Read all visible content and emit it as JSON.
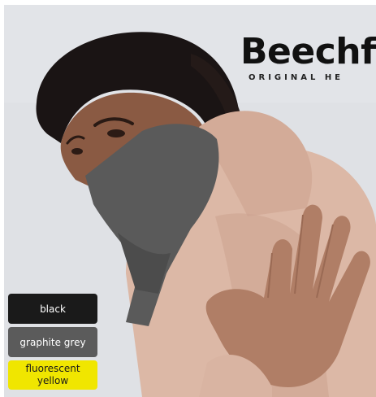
{
  "brand": {
    "name": "Beechf",
    "tagline": "ORIGINAL HE"
  },
  "swatches": [
    {
      "label": "black",
      "color": "#1a1a1a"
    },
    {
      "label": "graphite grey",
      "color": "#5b5b5b"
    },
    {
      "label": "fluorescent yellow",
      "color": "#f0e600"
    }
  ],
  "colors": {
    "background": "#dfe1e5",
    "hoodie": "#dcb8a6",
    "snood": "#5a5a5a",
    "hair": "#1a1414",
    "skin": "#8a5a43"
  }
}
